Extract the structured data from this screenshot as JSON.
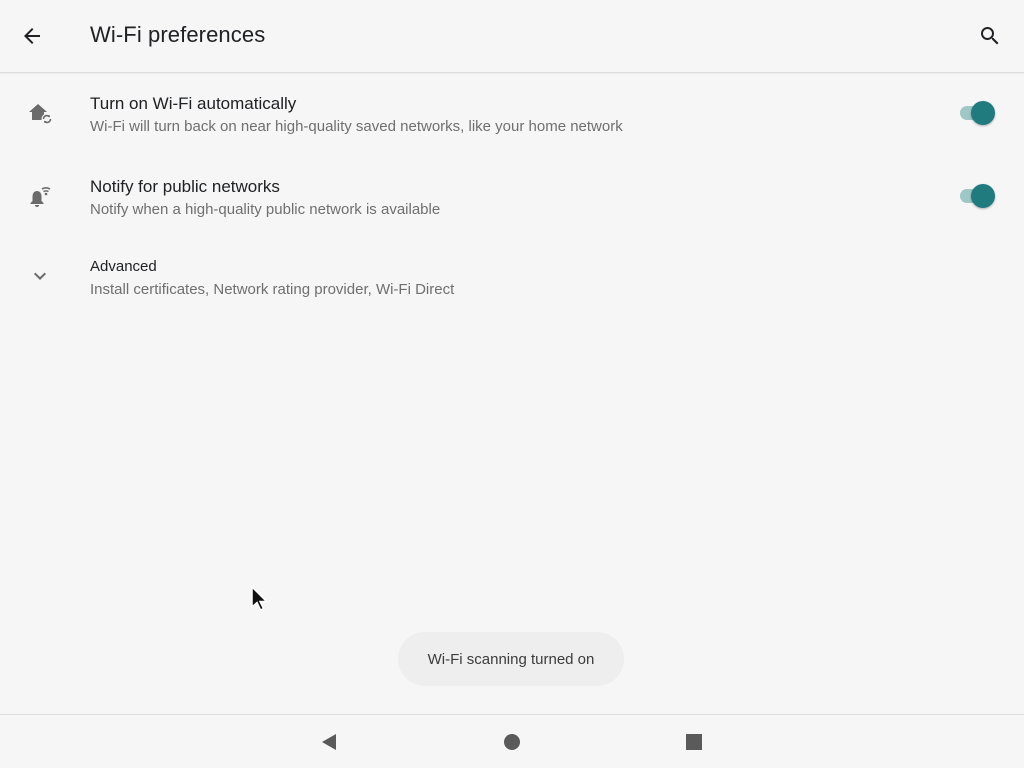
{
  "appbar": {
    "title": "Wi-Fi preferences",
    "back_icon": "arrow-back-icon",
    "search_icon": "search-icon"
  },
  "preferences": [
    {
      "title": "Turn on Wi-Fi automatically",
      "summary": "Wi-Fi will turn back on near high-quality saved networks, like your home network",
      "icon": "home-wifi-auto-icon",
      "switch_on": true
    },
    {
      "title": "Notify for public networks",
      "summary": "Notify when a high-quality public network is available",
      "icon": "notification-wifi-icon",
      "switch_on": true
    },
    {
      "title": "Advanced",
      "summary": "Install certificates, Network rating provider, Wi-Fi Direct",
      "icon": "chevron-down-icon"
    }
  ],
  "toast": {
    "text": "Wi-Fi scanning turned on"
  },
  "navbar": {
    "back_icon": "nav-back-icon",
    "home_icon": "nav-home-icon",
    "recents_icon": "nav-recents-icon"
  },
  "colors": {
    "background": "#f6f6f6",
    "accent": "#1f7b7e",
    "switch_track": "#9fc7c6",
    "secondary_text": "#6f6f6f"
  }
}
